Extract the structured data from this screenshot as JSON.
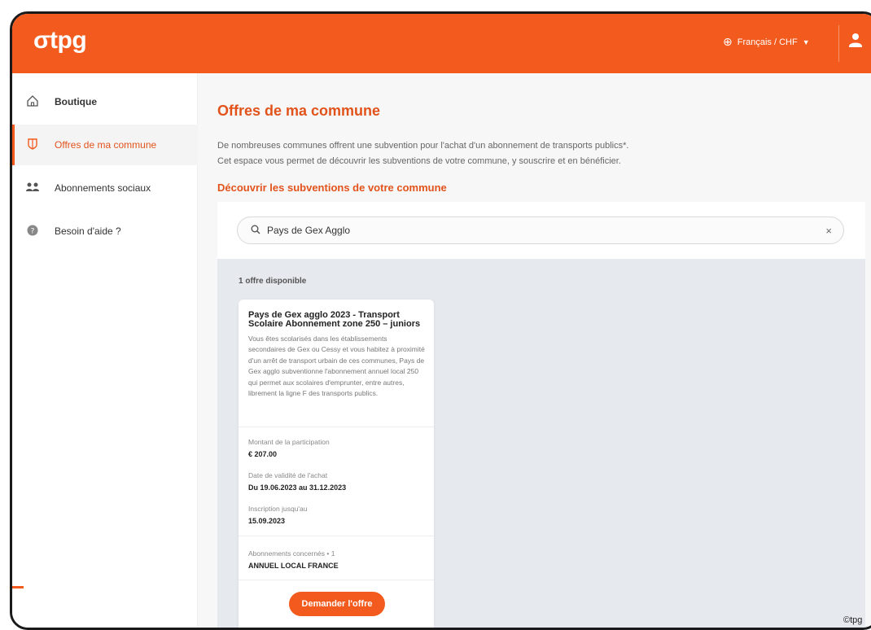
{
  "header": {
    "logo": "σtpg",
    "language": "Français / CHF",
    "icons": [
      "globe-icon",
      "caret-down-icon",
      "user-icon"
    ]
  },
  "sidebar": {
    "items": [
      {
        "label": "Boutique",
        "icon": "home-icon",
        "active": false
      },
      {
        "label": "Offres de ma commune",
        "icon": "shield-icon",
        "active": true
      },
      {
        "label": "Abonnements sociaux",
        "icon": "people-icon",
        "active": false
      },
      {
        "label": "Besoin d'aide ?",
        "icon": "help-icon",
        "active": false
      }
    ]
  },
  "main": {
    "title": "Offres de ma commune",
    "intro_line1": "De nombreuses communes offrent une subvention pour l'achat d'un abonnement de transports publics*.",
    "intro_line2": "Cet espace vous permet de découvrir les subventions de votre commune, y souscrire et en bénéficier.",
    "section_title": "Découvrir les subventions de votre commune",
    "search": {
      "value": "Pays de Gex Agglo",
      "clear": "×"
    },
    "results_count": "1 offre disponible",
    "offer": {
      "title": "Pays de Gex agglo 2023 - Transport Scolaire Abonnement zone 250 – juniors",
      "description": "Vous êtes scolarisés dans les établissements secondaires de Gex ou Cessy et vous habitez à proximité d'un arrêt de transport urbain de ces communes, Pays de Gex agglo subventionne l'abonnement annuel local 250 qui permet aux scolaires d'emprunter, entre autres, librement la ligne F des transports publics.",
      "amount_label": "Montant de la participation",
      "amount_value": "€ 207.00",
      "validity_label": "Date de validité de l'achat",
      "validity_value": "Du 19.06.2023 au 31.12.2023",
      "registration_label": "Inscription jusqu'au",
      "registration_value": "15.09.2023",
      "subs_label": "Abonnements concernés • 1",
      "subs_value": "ANNUEL LOCAL FRANCE",
      "cta": "Demander l'offre"
    }
  },
  "footer": {
    "copyright": "©tpg"
  },
  "colors": {
    "brand": "#f25b1d",
    "accent_text": "#e2531c",
    "results_bg": "#e6e9ee"
  }
}
